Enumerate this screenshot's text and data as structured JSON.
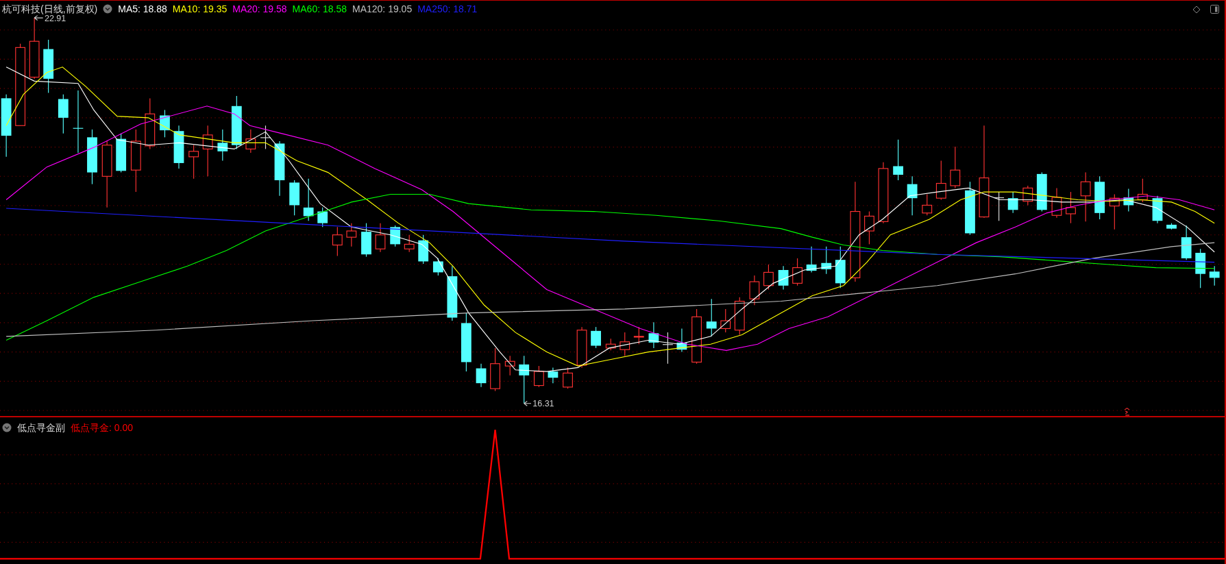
{
  "header": {
    "title": "杭可科技(日线,前复权)",
    "legend": [
      {
        "text": "MA5: 18.88",
        "color": "#ffffff"
      },
      {
        "text": "MA10: 19.35",
        "color": "#ffff00"
      },
      {
        "text": "MA20: 19.58",
        "color": "#ff00ff"
      },
      {
        "text": "MA60: 18.58",
        "color": "#00ff00"
      },
      {
        "text": "MA120: 19.05",
        "color": "#c0c0c0"
      },
      {
        "text": "MA250: 18.71",
        "color": "#1f1fff"
      }
    ]
  },
  "price_chart": {
    "high_label": "22.91",
    "low_label": "16.31"
  },
  "indicator": {
    "name": "低点寻金副",
    "legend": [
      {
        "text": "低点寻金: 0.00",
        "color": "#ff0000"
      }
    ]
  }
}
